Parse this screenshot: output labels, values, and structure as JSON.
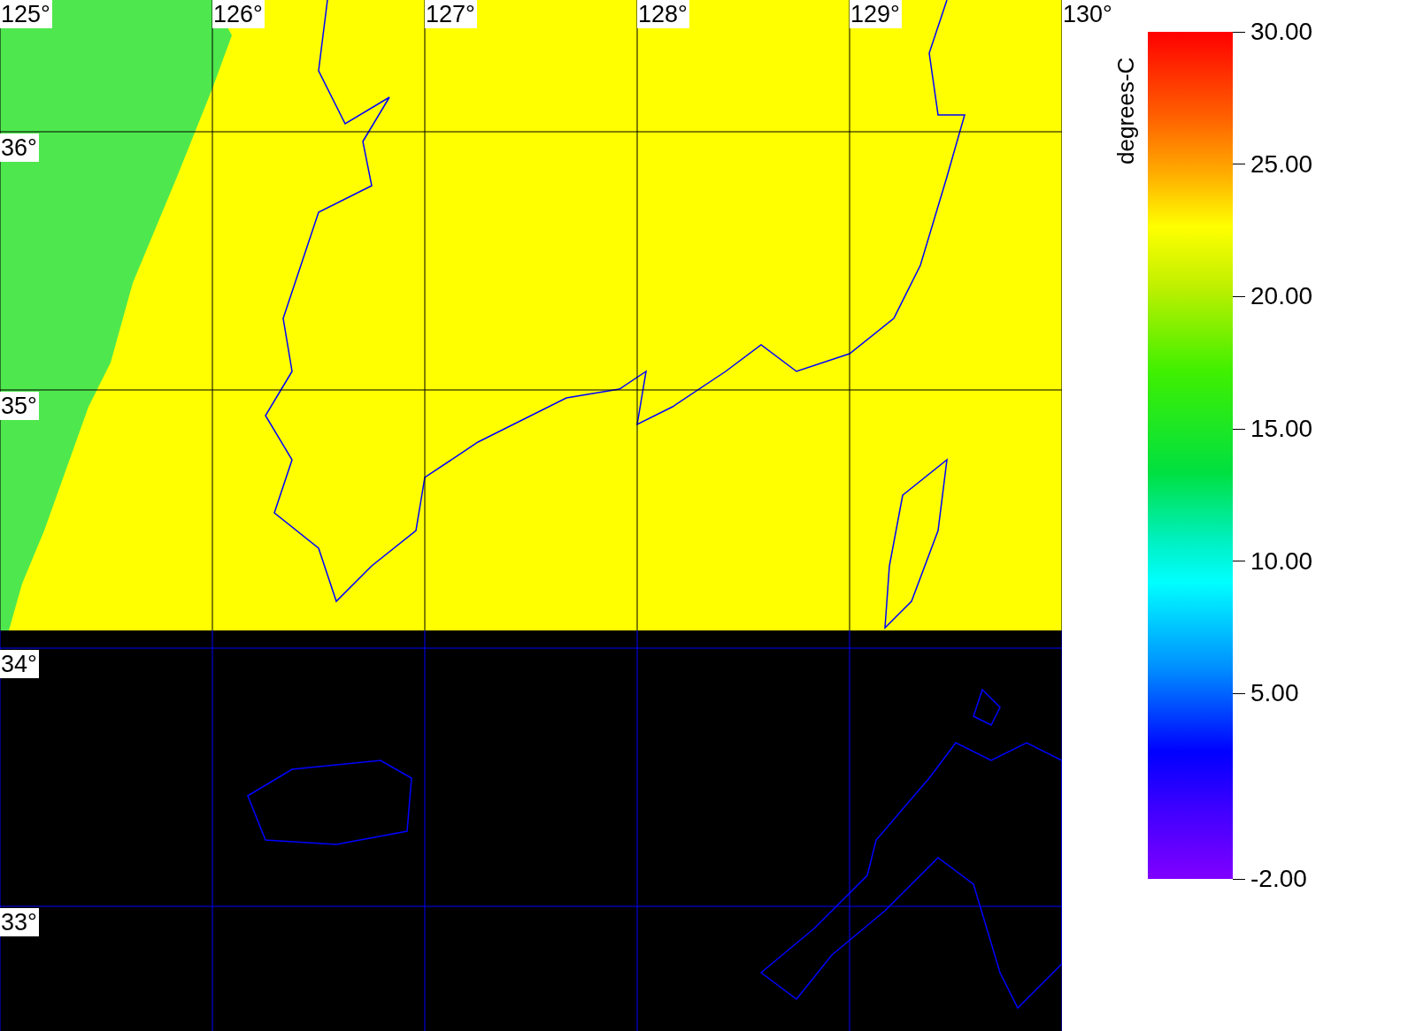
{
  "map": {
    "lon_labels": [
      "125°",
      "126°",
      "127°",
      "128°",
      "129°",
      "130°"
    ],
    "lat_labels": [
      "36°",
      "35°",
      "34°",
      "33°"
    ]
  },
  "colorbar": {
    "unit": "degrees-C",
    "ticks": [
      "30.00",
      "25.00",
      "20.00",
      "15.00",
      "10.00",
      "5.00",
      "-2.00"
    ]
  }
}
